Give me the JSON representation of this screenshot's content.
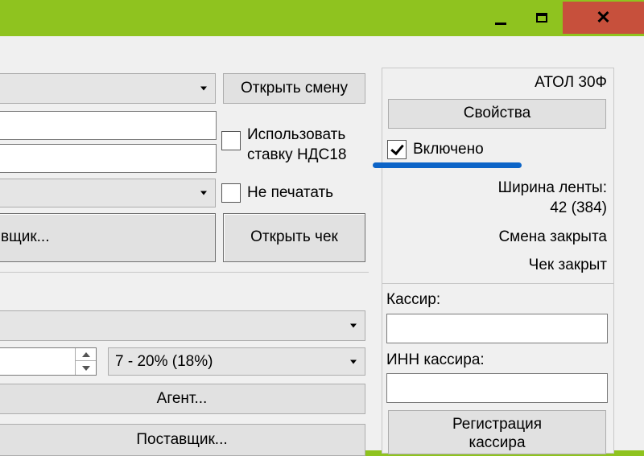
{
  "window": {
    "minimize_icon": "minimize-icon",
    "maximize_icon": "maximize-icon",
    "close_icon": "close-icon",
    "close_glyph": "✕",
    "accent": "#8fc31f",
    "close_color": "#c7503c"
  },
  "left": {
    "open_shift_label": "Открыть смену",
    "use_vat18_label_line1": "Использовать",
    "use_vat18_label_line2": "ставку НДС18",
    "no_print_label": "Не печатать",
    "supplier_button_partial": "вщик...",
    "open_receipt_label": "Открыть чек",
    "vat_select_value": "7 - 20% (18%)",
    "agent_label": "Агент...",
    "supplier_label": "Поставщик..."
  },
  "right": {
    "device_name": "АТОЛ 30Ф",
    "properties_label": "Свойства",
    "enabled_label": "Включено",
    "enabled_checked": true,
    "tape_width_label": "Ширина ленты:",
    "tape_width_value": "42 (384)",
    "shift_status": "Смена закрыта",
    "receipt_status": "Чек закрыт",
    "cashier_label": "Кассир:",
    "cashier_value": "",
    "cashier_inn_label": "ИНН кассира:",
    "cashier_inn_value": "",
    "register_cashier_line1": "Регистрация",
    "register_cashier_line2": "кассира"
  }
}
